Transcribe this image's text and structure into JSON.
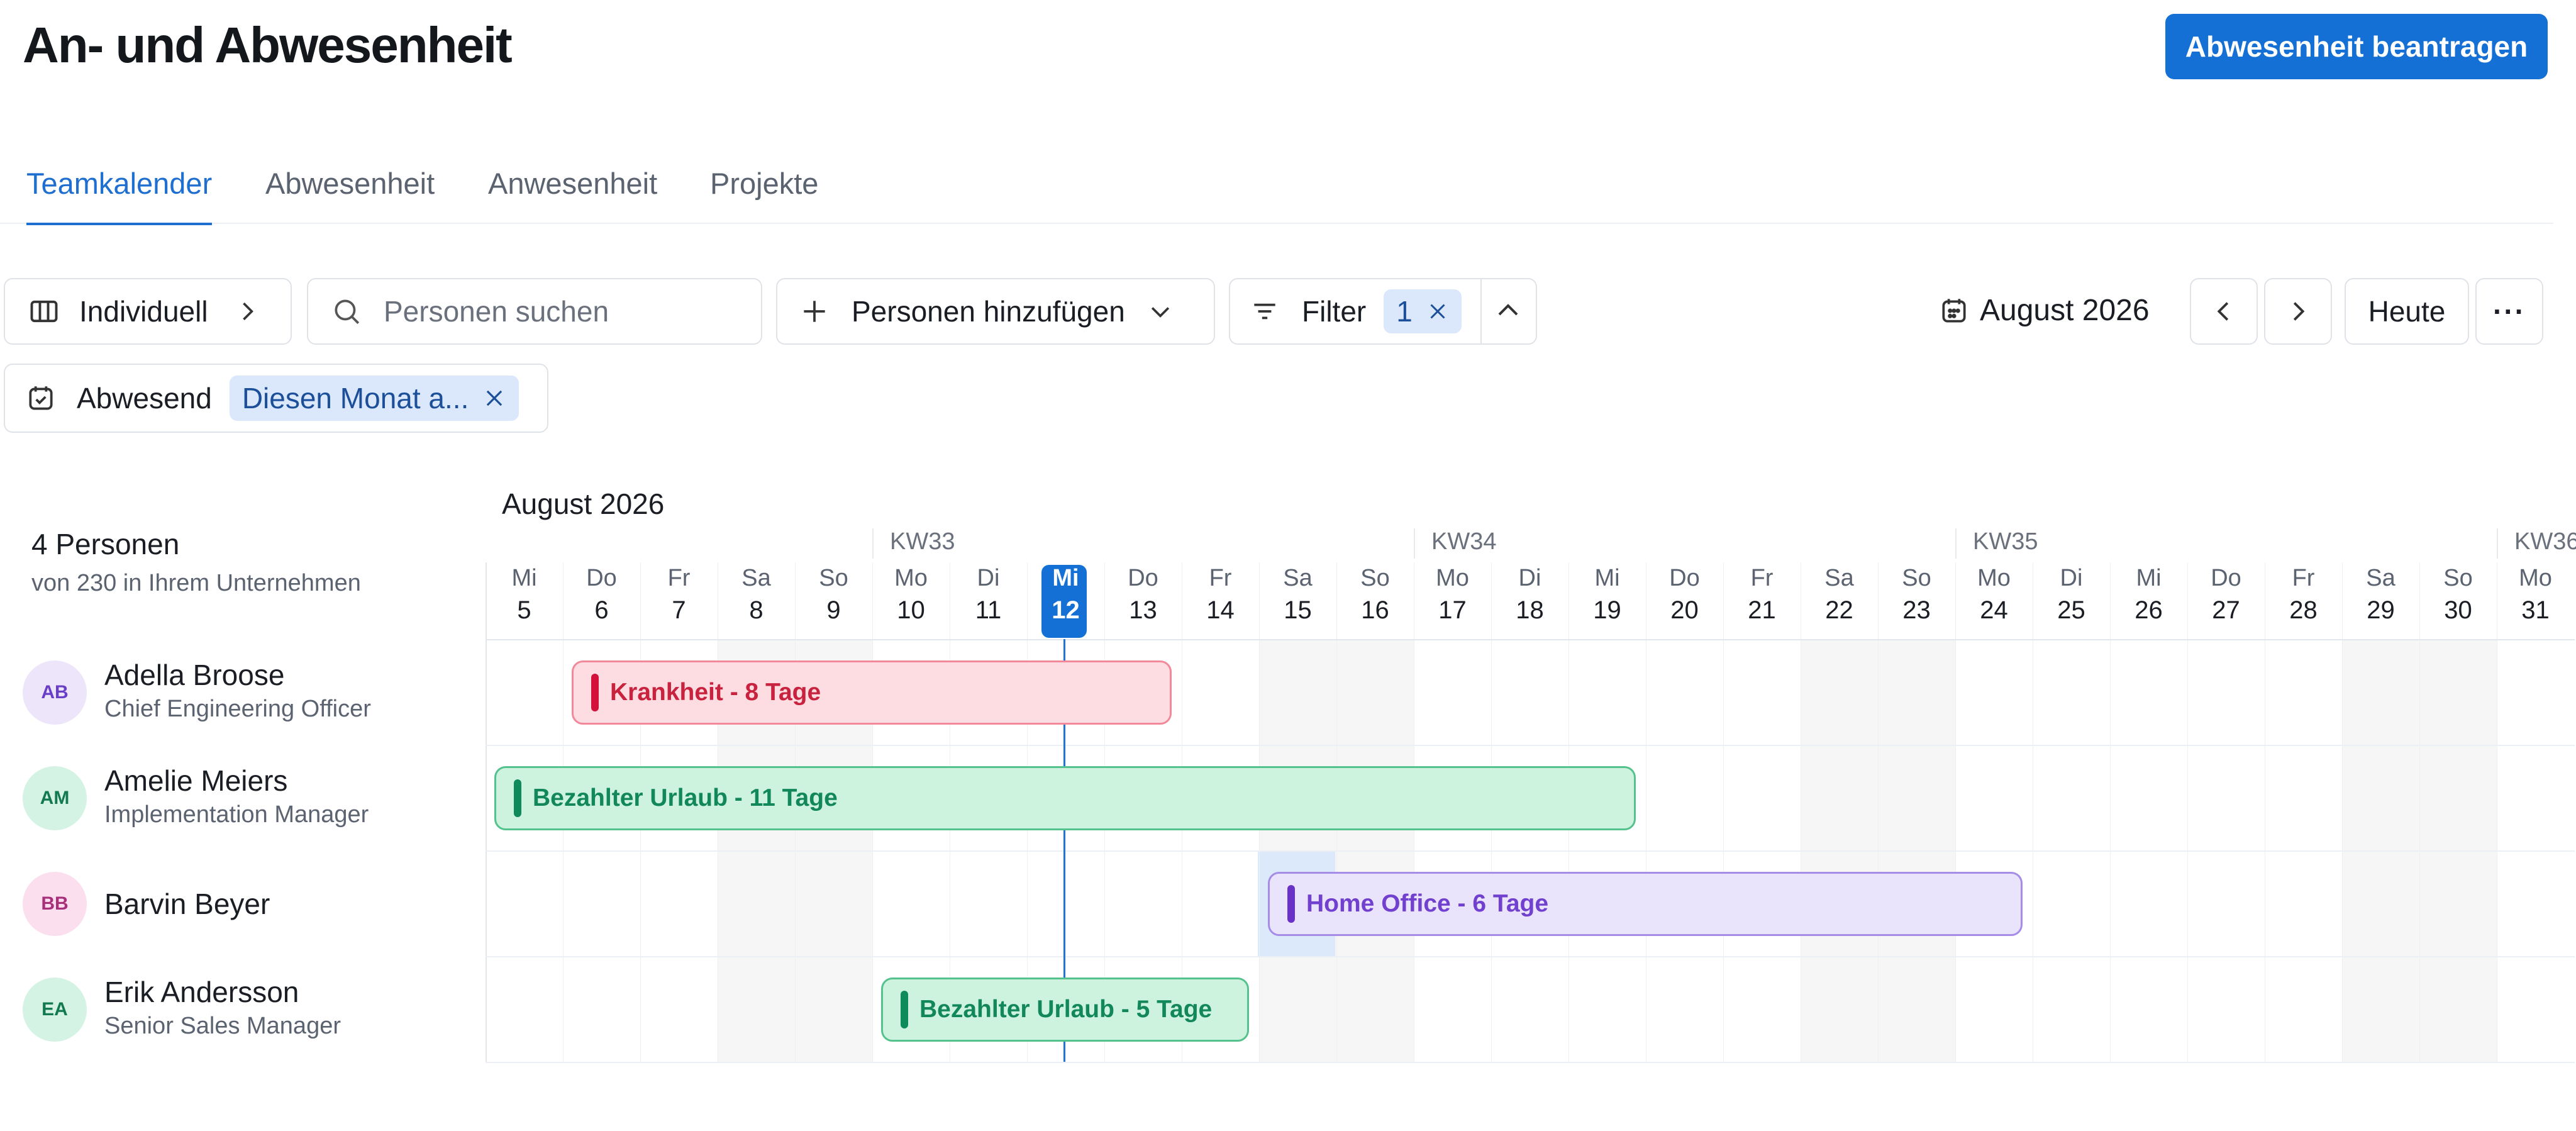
{
  "page": {
    "title": "An- und Abwesenheit",
    "request_button": "Abwesenheit beantragen"
  },
  "tabs": [
    {
      "label": "Teamkalender",
      "active": true
    },
    {
      "label": "Abwesenheit",
      "active": false
    },
    {
      "label": "Anwesenheit",
      "active": false
    },
    {
      "label": "Projekte",
      "active": false
    }
  ],
  "toolbar": {
    "view_label": "Individuell",
    "search_placeholder": "Personen suchen",
    "add_people_label": "Personen hinzufügen",
    "filter_label": "Filter",
    "filter_count": "1",
    "month_label": "August 2026",
    "today_label": "Heute",
    "more_label": "···"
  },
  "active_filter": {
    "label": "Abwesend",
    "value": "Diesen Monat a..."
  },
  "calendar": {
    "month_heading": "August 2026",
    "people_count": "4 Personen",
    "people_sub": "von 230 in Ihrem Unternehmen",
    "weeks": [
      "KW33",
      "KW34",
      "KW35",
      "KW36"
    ],
    "days": [
      {
        "name": "Mi",
        "num": "5"
      },
      {
        "name": "Do",
        "num": "6"
      },
      {
        "name": "Fr",
        "num": "7"
      },
      {
        "name": "Sa",
        "num": "8"
      },
      {
        "name": "So",
        "num": "9"
      },
      {
        "name": "Mo",
        "num": "10"
      },
      {
        "name": "Di",
        "num": "11"
      },
      {
        "name": "Mi",
        "num": "12"
      },
      {
        "name": "Do",
        "num": "13"
      },
      {
        "name": "Fr",
        "num": "14"
      },
      {
        "name": "Sa",
        "num": "15"
      },
      {
        "name": "So",
        "num": "16"
      },
      {
        "name": "Mo",
        "num": "17"
      },
      {
        "name": "Di",
        "num": "18"
      },
      {
        "name": "Mi",
        "num": "19"
      },
      {
        "name": "Do",
        "num": "20"
      },
      {
        "name": "Fr",
        "num": "21"
      },
      {
        "name": "Sa",
        "num": "22"
      },
      {
        "name": "So",
        "num": "23"
      },
      {
        "name": "Mo",
        "num": "24"
      },
      {
        "name": "Di",
        "num": "25"
      },
      {
        "name": "Mi",
        "num": "26"
      },
      {
        "name": "Do",
        "num": "27"
      },
      {
        "name": "Fr",
        "num": "28"
      },
      {
        "name": "Sa",
        "num": "29"
      },
      {
        "name": "So",
        "num": "30"
      },
      {
        "name": "Mo",
        "num": "31"
      }
    ],
    "today_index": 7,
    "people": [
      {
        "initials": "AB",
        "name": "Adella Broose",
        "role": "Chief Engineering Officer",
        "avatar_bg": "#ede6fb",
        "avatar_fg": "#6a3fc7",
        "absence": {
          "label": "Krankheit - 8 Tage",
          "kind": "sick",
          "start": "2026-08-06",
          "end": "2026-08-13"
        }
      },
      {
        "initials": "AM",
        "name": "Amelie Meiers",
        "role": "Implementation Manager",
        "avatar_bg": "#d5f3e5",
        "avatar_fg": "#13794f",
        "absence": {
          "label": "Bezahlter Urlaub - 11 Tage",
          "kind": "vacation",
          "start": "2026-08-05",
          "end": "2026-08-19"
        }
      },
      {
        "initials": "BB",
        "name": "Barvin Beyer",
        "role": "",
        "avatar_bg": "#fbdfee",
        "avatar_fg": "#a8307a",
        "absence": {
          "label": "Home Office - 6 Tage",
          "kind": "homeoffice",
          "start": "2026-08-15",
          "end": "2026-08-24"
        }
      },
      {
        "initials": "EA",
        "name": "Erik Andersson",
        "role": "Senior Sales Manager",
        "avatar_bg": "#d5f3e5",
        "avatar_fg": "#13794f",
        "absence": {
          "label": "Bezahlter Urlaub - 5 Tage",
          "kind": "vacation",
          "start": "2026-08-10",
          "end": "2026-08-14"
        }
      }
    ]
  },
  "colors": {
    "accent": "#1570d6",
    "sick": "#d4113a",
    "vacation": "#0e8a5b",
    "homeoffice": "#6a31c9"
  }
}
